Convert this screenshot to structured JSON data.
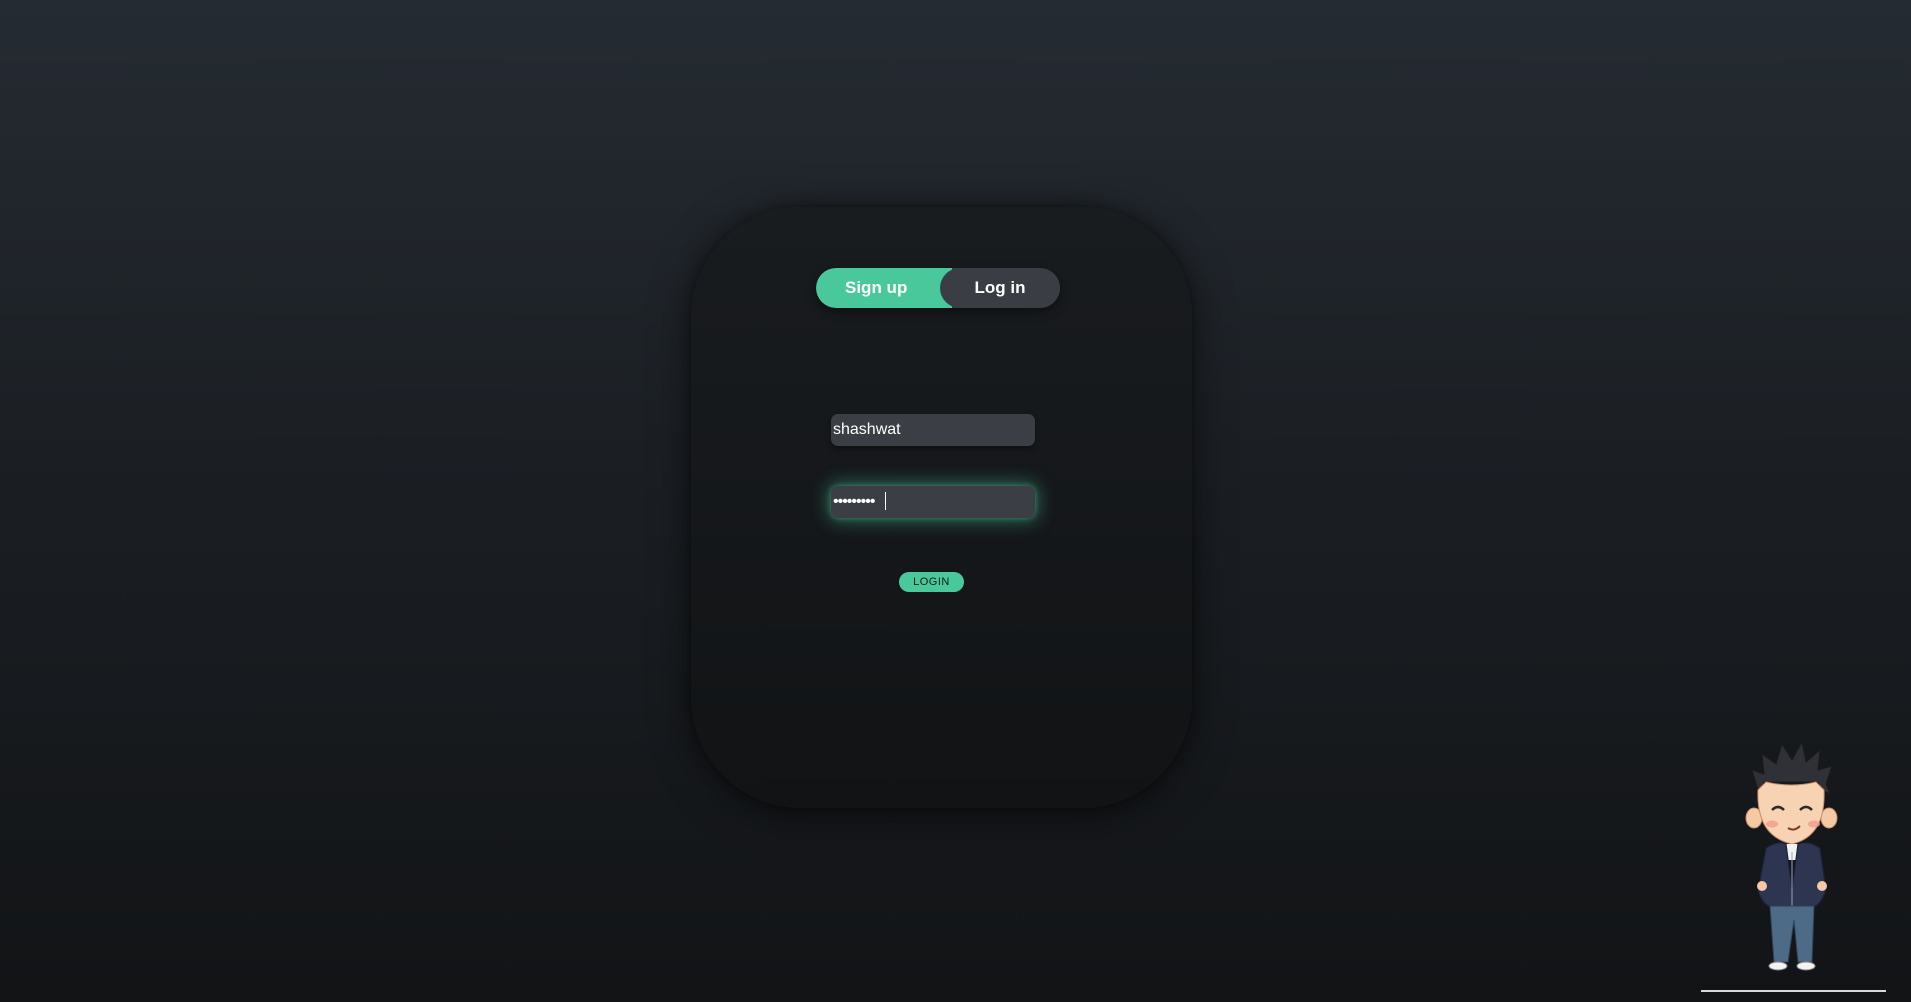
{
  "auth": {
    "toggle": {
      "signup_label": "Sign up",
      "login_label": "Log in",
      "active": "signup"
    },
    "username": {
      "value": "shashwat"
    },
    "password": {
      "value": "•••••••••"
    },
    "submit_label": "LOGIN"
  },
  "theme": {
    "accent": "#49c99b",
    "field_bg": "#3b3e44",
    "card_bg": "#15181b",
    "page_bg_top": "#252b32",
    "page_bg_bottom": "#121416"
  },
  "decor": {
    "character": "cartoon-boy-illustration"
  }
}
